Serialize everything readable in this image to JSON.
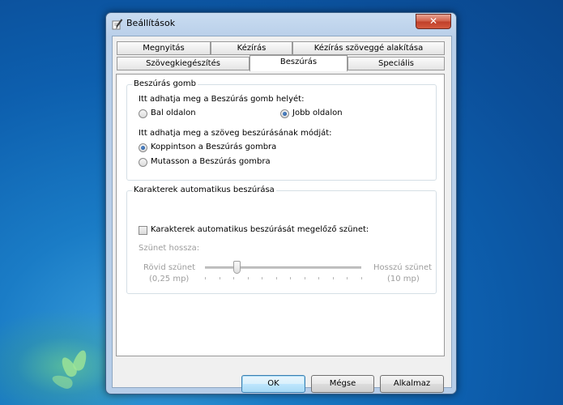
{
  "window": {
    "title": "Beállítások",
    "close_glyph": "✕"
  },
  "tabs": {
    "row1": [
      "Megnyitás",
      "Kézírás",
      "Kézírás szöveggé alakítása"
    ],
    "row2": [
      "Szövegkiegészítés",
      "Beszúrás",
      "Speciális"
    ],
    "active": "Beszúrás"
  },
  "insert_button_group": {
    "title": "Beszúrás gomb",
    "location_prompt": "Itt adhatja meg a Beszúrás gomb helyét:",
    "location_left": "Bal oldalon",
    "location_right": "Jobb oldalon",
    "location_selected": "Jobb oldalon",
    "mode_prompt": "Itt adhatja meg a szöveg beszúrásának módját:",
    "mode_tap": "Koppintson a Beszúrás gombra",
    "mode_hover": "Mutasson a Beszúrás gombra",
    "mode_selected": "Koppintson a Beszúrás gombra"
  },
  "auto_insert_group": {
    "title": "Karakterek automatikus beszúrása",
    "pause_checkbox_label": "Karakterek automatikus beszúrását megelőző szünet:",
    "pause_checked": false,
    "pause_length_label": "Szünet hossza:",
    "short_label": "Rövid szünet",
    "short_value": "(0,25 mp)",
    "long_label": "Hosszú szünet",
    "long_value": "(10 mp)",
    "slider_fraction": 0.2,
    "slider_tick_count": 12
  },
  "buttons": {
    "ok": "OK",
    "cancel": "Mégse",
    "apply": "Alkalmaz"
  },
  "colors": {
    "desktop": "#0d5fae",
    "selection_dot": "#1a4c8f",
    "default_button_border": "#3c7fb1"
  }
}
